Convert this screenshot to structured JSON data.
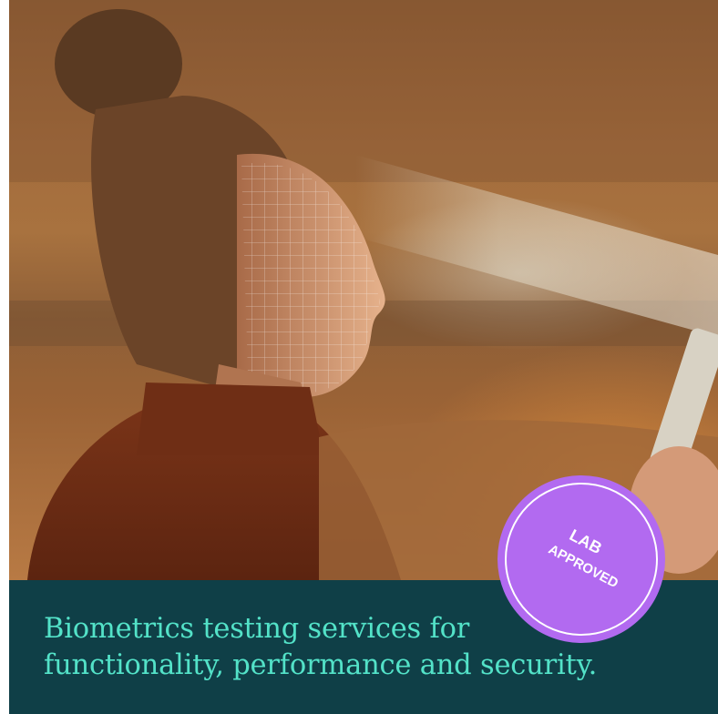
{
  "hero": {
    "image_alt_icon": "face-scan-photo",
    "colors": {
      "caption_bg": "#0f3f47",
      "caption_text": "#53e2c8",
      "badge_bg": "#b26af0"
    }
  },
  "badge": {
    "line1": "LAB",
    "line2": "APPROVED"
  },
  "caption": {
    "line1": "Biometrics testing services for",
    "line2": "functionality, performance and security."
  }
}
